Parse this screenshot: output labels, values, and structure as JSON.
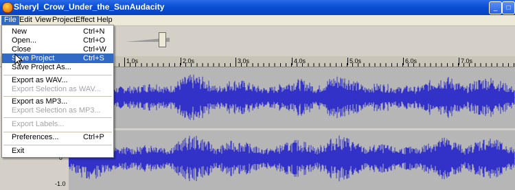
{
  "window": {
    "title": "Sheryl_Crow_Under_the_SunAudacity",
    "min": "_",
    "max": "□",
    "close": "✕"
  },
  "menubar": [
    "File",
    "Edit",
    "View",
    "Project",
    "Effect",
    "Help"
  ],
  "file_menu": {
    "items": [
      {
        "label": "New",
        "shortcut": "Ctrl+N",
        "enabled": true
      },
      {
        "label": "Open...",
        "shortcut": "Ctrl+O",
        "enabled": true
      },
      {
        "label": "Close",
        "shortcut": "Ctrl+W",
        "enabled": true
      },
      {
        "label": "Save Project",
        "shortcut": "Ctrl+S",
        "enabled": true,
        "highlighted": true
      },
      {
        "label": "Save Project As...",
        "shortcut": "",
        "enabled": true
      },
      {
        "label": "Export as WAV...",
        "shortcut": "",
        "enabled": true
      },
      {
        "label": "Export Selection as WAV...",
        "shortcut": "",
        "enabled": false
      },
      {
        "label": "Export as MP3...",
        "shortcut": "",
        "enabled": true
      },
      {
        "label": "Export Selection as MP3...",
        "shortcut": "",
        "enabled": false
      },
      {
        "label": "Export Labels...",
        "shortcut": "",
        "enabled": false
      },
      {
        "label": "Preferences...",
        "shortcut": "Ctrl+P",
        "enabled": true
      },
      {
        "label": "Exit",
        "shortcut": "",
        "enabled": true
      }
    ]
  },
  "ruler": {
    "ticks": [
      "1.0s",
      "2.0s",
      "3.0s",
      "4.0s",
      "5.0s",
      "6.0s",
      "7.0s"
    ]
  },
  "tracks": {
    "scale_zero": "0",
    "scale_min": "-1.0",
    "wave_color": "#3232c8",
    "background": "#b6b6b6"
  }
}
